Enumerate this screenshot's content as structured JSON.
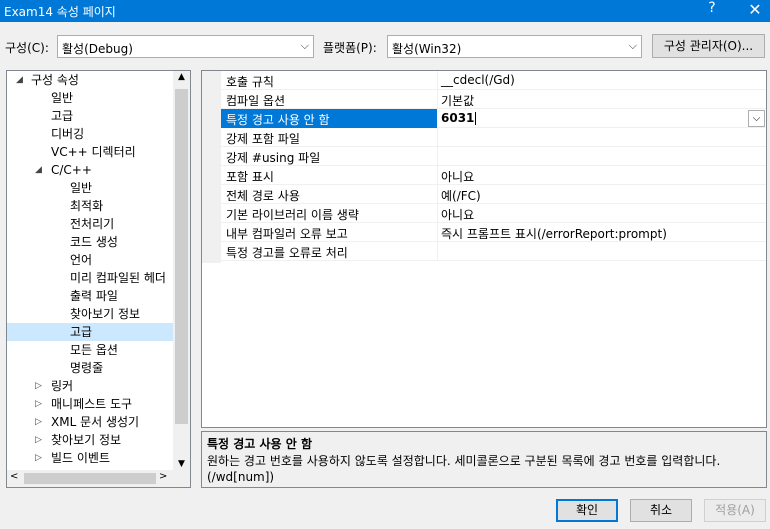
{
  "window": {
    "title": "Exam14 속성 페이지",
    "help": "?",
    "close": "✕"
  },
  "config": {
    "label": "구성(C):",
    "value": "활성(Debug)"
  },
  "platform": {
    "label": "플랫폼(P):",
    "value": "활성(Win32)"
  },
  "config_manager_label": "구성 관리자(O)...",
  "tree": {
    "items": [
      {
        "label": "구성 속성",
        "twisty": "◢"
      },
      {
        "label": "일반"
      },
      {
        "label": "고급"
      },
      {
        "label": "디버깅"
      },
      {
        "label": "VC++ 디렉터리"
      },
      {
        "label": "C/C++",
        "twisty": "◢"
      },
      {
        "label": "일반"
      },
      {
        "label": "최적화"
      },
      {
        "label": "전처리기"
      },
      {
        "label": "코드 생성"
      },
      {
        "label": "언어"
      },
      {
        "label": "미리 컴파일된 헤더"
      },
      {
        "label": "출력 파일"
      },
      {
        "label": "찾아보기 정보"
      },
      {
        "label": "고급"
      },
      {
        "label": "모든 옵션"
      },
      {
        "label": "명령줄"
      },
      {
        "label": "링커",
        "twisty": "▷"
      },
      {
        "label": "매니페스트 도구",
        "twisty": "▷"
      },
      {
        "label": "XML 문서 생성기",
        "twisty": "▷"
      },
      {
        "label": "찾아보기 정보",
        "twisty": "▷"
      },
      {
        "label": "빌드 이벤트",
        "twisty": "▷"
      }
    ]
  },
  "properties": [
    {
      "name": "호출 규칙",
      "value": "__cdecl(/Gd)"
    },
    {
      "name": "컴파일 옵션",
      "value": "기본값"
    },
    {
      "name": "특정 경고 사용 안 함",
      "value": "6031"
    },
    {
      "name": "강제 포함 파일",
      "value": ""
    },
    {
      "name": "강제 #using 파일",
      "value": ""
    },
    {
      "name": "포함 표시",
      "value": "아니요"
    },
    {
      "name": "전체 경로 사용",
      "value": "예(/FC)"
    },
    {
      "name": "기본 라이브러리 이름 생략",
      "value": "아니요"
    },
    {
      "name": "내부 컴파일러 오류 보고",
      "value": "즉시 프롬프트 표시(/errorReport:prompt)"
    },
    {
      "name": "특정 경고를 오류로 처리",
      "value": ""
    }
  ],
  "description": {
    "title": "특정 경고 사용 안 함",
    "text": "원하는 경고 번호를 사용하지 않도록 설정합니다. 세미콜론으로 구분된 목록에 경고 번호를 입력합니다.     (/wd[num])"
  },
  "buttons": {
    "ok": "확인",
    "cancel": "취소",
    "apply": "적용(A)"
  },
  "colors": {
    "accent": "#0078d7",
    "tree_selection": "#cce8ff"
  },
  "icons": {
    "dropdown": "chevron-down-icon",
    "expanded": "expanded-triangle-icon",
    "collapsed": "collapsed-triangle-icon"
  }
}
